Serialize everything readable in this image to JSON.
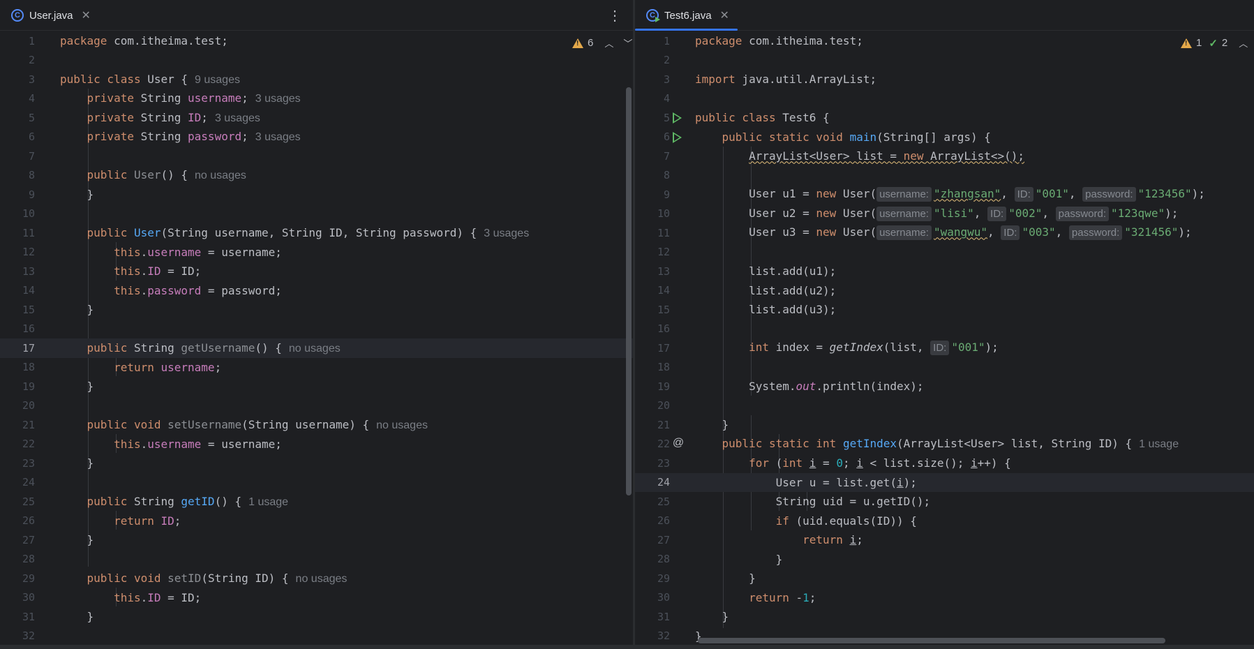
{
  "left": {
    "tab": {
      "file_name": "User.java",
      "icon": "class-icon",
      "icon_glyph": "C"
    },
    "more_label": "⋮",
    "inspection": {
      "warnings": "6"
    },
    "lines": [
      {
        "n": "1"
      },
      {
        "n": "2"
      },
      {
        "n": "3",
        "hint": "9 usages"
      },
      {
        "n": "4",
        "hint": "3 usages"
      },
      {
        "n": "5",
        "hint": "3 usages"
      },
      {
        "n": "6",
        "hint": "3 usages"
      },
      {
        "n": "7"
      },
      {
        "n": "8",
        "hint": "no usages"
      },
      {
        "n": "9"
      },
      {
        "n": "10"
      },
      {
        "n": "11",
        "hint": "3 usages"
      },
      {
        "n": "12"
      },
      {
        "n": "13"
      },
      {
        "n": "14"
      },
      {
        "n": "15"
      },
      {
        "n": "16"
      },
      {
        "n": "17",
        "hint": "no usages"
      },
      {
        "n": "18"
      },
      {
        "n": "19"
      },
      {
        "n": "20"
      },
      {
        "n": "21",
        "hint": "no usages"
      },
      {
        "n": "22"
      },
      {
        "n": "23"
      },
      {
        "n": "24"
      },
      {
        "n": "25",
        "hint": "1 usage"
      },
      {
        "n": "26"
      },
      {
        "n": "27"
      },
      {
        "n": "28"
      },
      {
        "n": "29",
        "hint": "no usages"
      },
      {
        "n": "30"
      },
      {
        "n": "31"
      },
      {
        "n": "32"
      }
    ]
  },
  "right": {
    "tab": {
      "file_name": "Test6.java",
      "icon": "runnable-class-icon",
      "icon_glyph": "C"
    },
    "inspection": {
      "warnings": "1",
      "ok": "2"
    },
    "hints": {
      "line22": "1 usage"
    },
    "inlays": {
      "username": "username:",
      "id": "ID:",
      "password": "password:"
    },
    "strings": {
      "u1_name": "\"zhangsan\"",
      "u1_id": "\"001\"",
      "u1_pw": "\"123456\"",
      "u2_name": "\"lisi\"",
      "u2_id": "\"002\"",
      "u2_pw": "\"123qwe\"",
      "u3_name": "\"wangwu\"",
      "u3_id": "\"003\"",
      "u3_pw": "\"321456\"",
      "lookup_id": "\"001\""
    },
    "lines": [
      {
        "n": "1"
      },
      {
        "n": "2"
      },
      {
        "n": "3"
      },
      {
        "n": "4"
      },
      {
        "n": "5"
      },
      {
        "n": "6"
      },
      {
        "n": "7"
      },
      {
        "n": "8"
      },
      {
        "n": "9"
      },
      {
        "n": "10"
      },
      {
        "n": "11"
      },
      {
        "n": "12"
      },
      {
        "n": "13"
      },
      {
        "n": "14"
      },
      {
        "n": "15"
      },
      {
        "n": "16"
      },
      {
        "n": "17"
      },
      {
        "n": "18"
      },
      {
        "n": "19"
      },
      {
        "n": "20"
      },
      {
        "n": "21"
      },
      {
        "n": "22"
      },
      {
        "n": "23"
      },
      {
        "n": "24"
      },
      {
        "n": "25"
      },
      {
        "n": "26"
      },
      {
        "n": "27"
      },
      {
        "n": "28"
      },
      {
        "n": "29"
      },
      {
        "n": "30"
      },
      {
        "n": "31"
      },
      {
        "n": "32"
      }
    ]
  },
  "colors": {
    "background": "#1e1f22",
    "keyword": "#cf8e6d",
    "field": "#c77dbb",
    "method_declaration": "#56a8f5",
    "string": "#6aab73",
    "number": "#2aacb8",
    "active_tab_underline": "#3574f0"
  }
}
